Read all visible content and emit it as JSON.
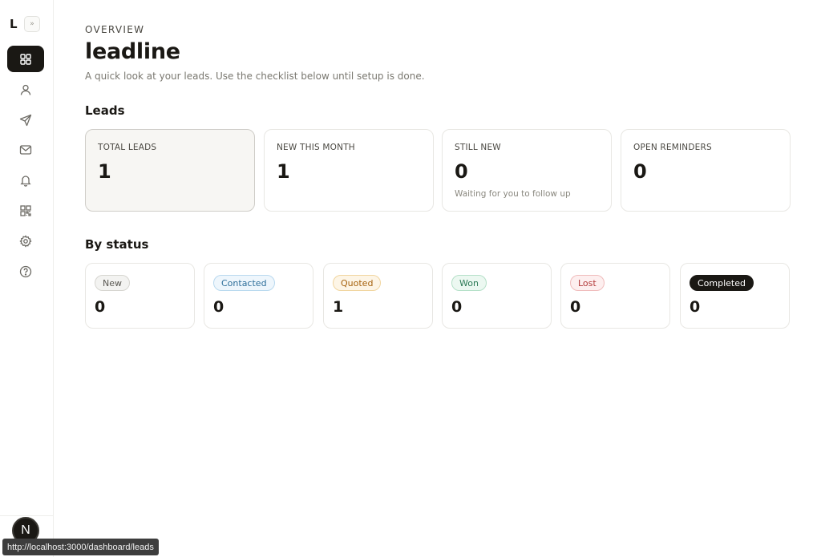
{
  "sidebar": {
    "brand": "L",
    "collapse_icon": "»",
    "items": [
      {
        "name": "dashboard",
        "icon": "grid-icon",
        "active": true
      },
      {
        "name": "contacts",
        "icon": "user-icon",
        "active": false
      },
      {
        "name": "send",
        "icon": "send-icon",
        "active": false
      },
      {
        "name": "mail",
        "icon": "mail-icon",
        "active": false
      },
      {
        "name": "reminders",
        "icon": "bell-icon",
        "active": false
      },
      {
        "name": "qr",
        "icon": "qr-icon",
        "active": false
      },
      {
        "name": "settings",
        "icon": "gear-icon",
        "active": false
      },
      {
        "name": "help",
        "icon": "help-icon",
        "active": false
      }
    ],
    "footer_badge": "N"
  },
  "header": {
    "eyebrow": "OVERVIEW",
    "title": "leadline",
    "subtitle": "A quick look at your leads. Use the checklist below until setup is done."
  },
  "leads": {
    "section_title": "Leads",
    "cards": [
      {
        "label": "TOTAL LEADS",
        "value": "1",
        "sub": ""
      },
      {
        "label": "NEW THIS MONTH",
        "value": "1",
        "sub": ""
      },
      {
        "label": "STILL NEW",
        "value": "0",
        "sub": "Waiting for you to follow up"
      },
      {
        "label": "OPEN REMINDERS",
        "value": "0",
        "sub": ""
      }
    ]
  },
  "by_status": {
    "section_title": "By status",
    "cards": [
      {
        "label": "New",
        "value": "0",
        "color": "#5a5852",
        "bg": "#f3f3f1",
        "border": "#d6d5d0"
      },
      {
        "label": "Contacted",
        "value": "0",
        "color": "#2f6f9a",
        "bg": "#eef6fc",
        "border": "#b9d9ef"
      },
      {
        "label": "Quoted",
        "value": "1",
        "color": "#a6620e",
        "bg": "#fdf5e6",
        "border": "#f1d59f"
      },
      {
        "label": "Won",
        "value": "0",
        "color": "#2b7a55",
        "bg": "#ecf8f1",
        "border": "#b5e0c8"
      },
      {
        "label": "Lost",
        "value": "0",
        "color": "#b23a3a",
        "bg": "#fdefef",
        "border": "#f0bcbc"
      },
      {
        "label": "Completed",
        "value": "0",
        "color": "#ffffff",
        "bg": "#1a1814",
        "border": "#1a1814"
      }
    ]
  },
  "status_bar": {
    "url": "http://localhost:3000/dashboard/leads"
  }
}
